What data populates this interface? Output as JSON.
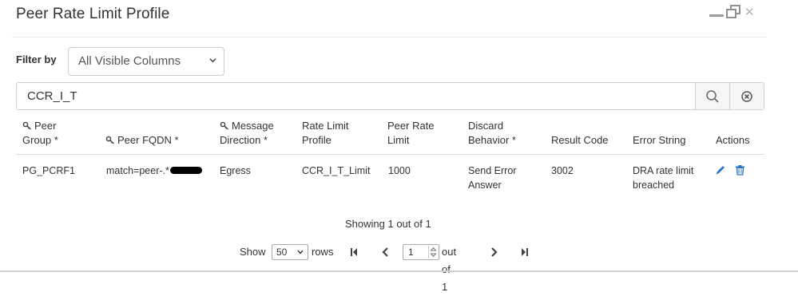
{
  "dialog": {
    "title": "Peer Rate Limit Profile"
  },
  "filter": {
    "label": "Filter by",
    "selected": "All Visible Columns"
  },
  "search": {
    "value": "CCR_I_T"
  },
  "table": {
    "headers": [
      {
        "line1": "Peer",
        "line2": "Group *",
        "key": true
      },
      {
        "line1": "Peer FQDN *",
        "line2": "",
        "key": true
      },
      {
        "line1": "Message",
        "line2": "Direction *",
        "key": true
      },
      {
        "line1": "Rate Limit",
        "line2": "Profile",
        "key": false
      },
      {
        "line1": "Peer Rate",
        "line2": "Limit",
        "key": false
      },
      {
        "line1": "Discard",
        "line2": "Behavior *",
        "key": false
      },
      {
        "line1": "Result Code",
        "line2": "",
        "key": false
      },
      {
        "line1": "Error String",
        "line2": "",
        "key": false
      },
      {
        "line1": "Actions",
        "line2": "",
        "key": false
      }
    ],
    "rows": [
      {
        "peer_group": "PG_PCRF1",
        "peer_fqdn": "match=peer-.*",
        "message_direction": "Egress",
        "rate_limit_profile": "CCR_I_T_Limit",
        "peer_rate_limit": "1000",
        "discard_line1": "Send Error",
        "discard_line2": "Answer",
        "result_code": "3002",
        "error_line1": "DRA rate limit",
        "error_line2": "breached"
      }
    ]
  },
  "footer": {
    "showing": "Showing 1 out of 1",
    "show_label": "Show",
    "rows_per_page": "50",
    "rows_label": "rows",
    "page": "1",
    "out_of": "out of 1"
  },
  "colors": {
    "action_blue": "#2a73c2",
    "border": "#cfcfcf"
  },
  "icons": {
    "search": "search-icon",
    "clear": "clear-circle-icon",
    "edit": "pencil-icon",
    "delete": "trash-icon",
    "key": "key-icon",
    "first": "first-page-icon",
    "prev": "prev-page-icon",
    "next": "next-page-icon",
    "last": "last-page-icon"
  }
}
